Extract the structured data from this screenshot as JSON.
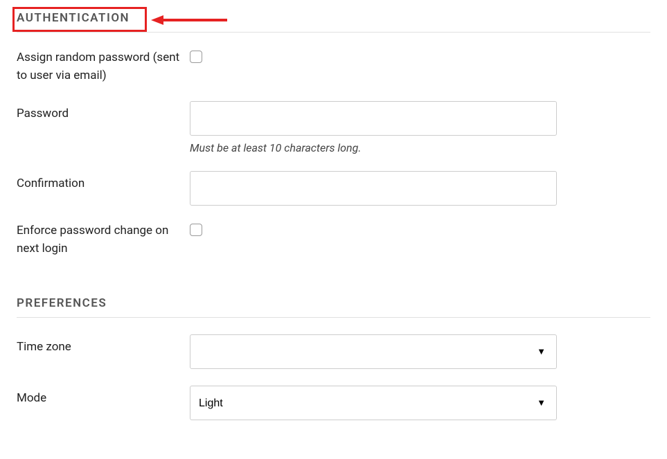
{
  "annotations": {
    "highlight_color": "#e62222"
  },
  "sections": {
    "authentication": {
      "title": "AUTHENTICATION",
      "fields": {
        "assign_random": {
          "label": "Assign random password (sent to user via email)",
          "checked": false
        },
        "password": {
          "label": "Password",
          "value": "",
          "help": "Must be at least 10 characters long."
        },
        "confirmation": {
          "label": "Confirmation",
          "value": ""
        },
        "enforce_change": {
          "label": "Enforce password change on next login",
          "checked": false
        }
      }
    },
    "preferences": {
      "title": "PREFERENCES",
      "fields": {
        "timezone": {
          "label": "Time zone",
          "value": ""
        },
        "mode": {
          "label": "Mode",
          "value": "Light"
        }
      }
    }
  }
}
